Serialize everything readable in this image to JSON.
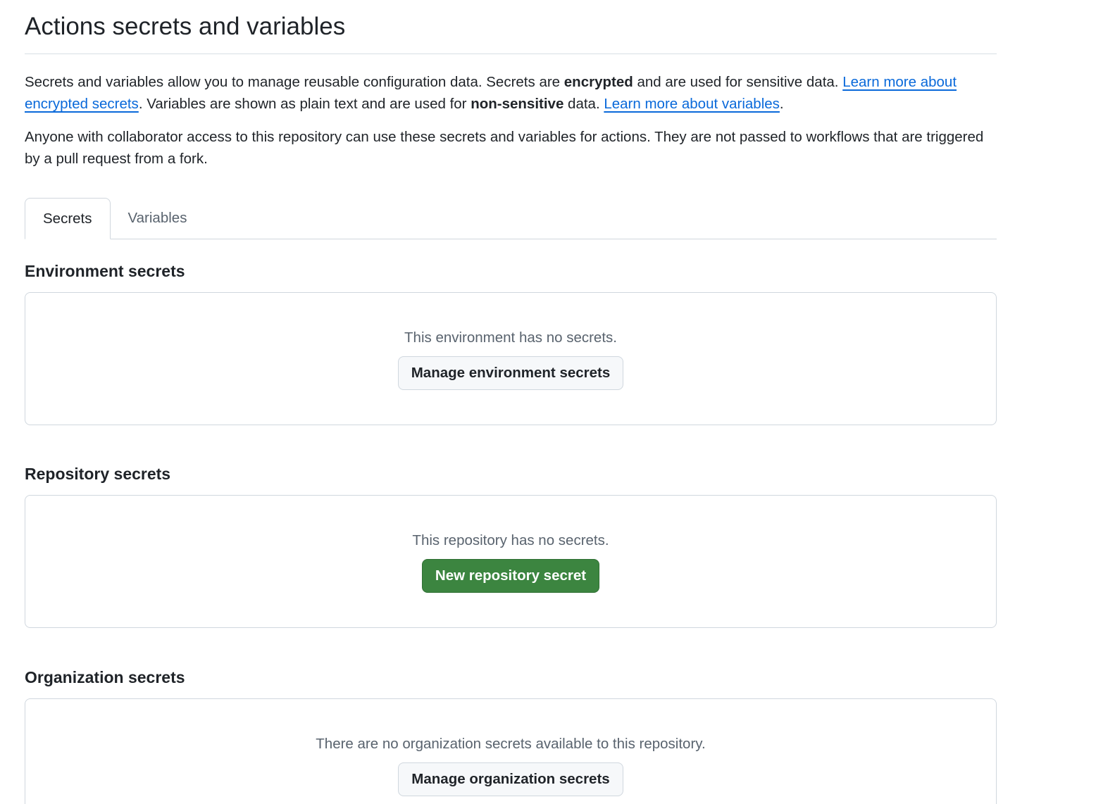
{
  "page": {
    "title": "Actions secrets and variables"
  },
  "intro": {
    "part1": "Secrets and variables allow you to manage reusable configuration data. Secrets are ",
    "bold1": "encrypted",
    "part2": " and are used for sensitive data. ",
    "link1": "Learn more about encrypted secrets",
    "part3": ". Variables are shown as plain text and are used for ",
    "bold2": "non-sensitive",
    "part4": " data. ",
    "link2": "Learn more about variables",
    "part5": ".",
    "paragraph2": "Anyone with collaborator access to this repository can use these secrets and variables for actions. They are not passed to workflows that are triggered by a pull request from a fork."
  },
  "tabs": [
    {
      "label": "Secrets",
      "active": true
    },
    {
      "label": "Variables",
      "active": false
    }
  ],
  "sections": {
    "environment": {
      "title": "Environment secrets",
      "empty_text": "This environment has no secrets.",
      "button": "Manage environment secrets"
    },
    "repository": {
      "title": "Repository secrets",
      "empty_text": "This repository has no secrets.",
      "button": "New repository secret"
    },
    "organization": {
      "title": "Organization secrets",
      "empty_text": "There are no organization secrets available to this repository.",
      "button": "Manage organization secrets"
    }
  },
  "colors": {
    "link": "#0969da",
    "primary_button": "#3c8540",
    "border": "#d0d7de",
    "muted_text": "#59636e"
  }
}
